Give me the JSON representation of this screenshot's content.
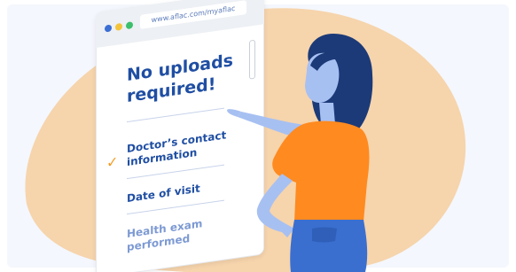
{
  "browser": {
    "url": "www.aflac.com/myaflac"
  },
  "content": {
    "heading_line1": "No uploads",
    "heading_line2": "required!",
    "items": [
      {
        "line1": "Doctor’s contact",
        "line2": "information",
        "checked": true
      },
      {
        "line1": "Date of visit",
        "line2": "",
        "checked": false
      },
      {
        "line1": "Health exam",
        "line2": "performed",
        "checked": false
      }
    ],
    "check_glyph": "✓"
  },
  "colors": {
    "blob": "#f6d4ac",
    "panel_bg": "#eef2fb",
    "heading": "#1f4ea3",
    "check": "#f39a1e",
    "shirt": "#ff8a1f",
    "hair": "#1c3a78",
    "skin": "#a7c0f2",
    "jeans": "#3a6fd0"
  },
  "icons": [
    "window-dot-blue",
    "window-dot-yellow",
    "window-dot-green",
    "check-icon",
    "scrollbar"
  ]
}
